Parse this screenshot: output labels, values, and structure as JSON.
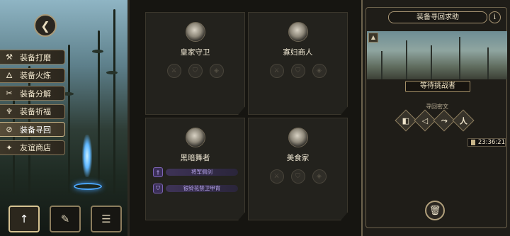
{
  "left_menu": {
    "items": [
      {
        "label": "装备打磨",
        "icon": "hammer-icon",
        "glyph": "⚒",
        "active": false
      },
      {
        "label": "装备火炼",
        "icon": "flame-icon",
        "glyph": "🜂",
        "active": false
      },
      {
        "label": "装备分解",
        "icon": "split-icon",
        "glyph": "✂",
        "active": false
      },
      {
        "label": "装备祈福",
        "icon": "prayer-icon",
        "glyph": "♆",
        "active": false
      },
      {
        "label": "装备寻回",
        "icon": "compass-icon",
        "glyph": "⊘",
        "active": true
      },
      {
        "label": "友谊商店",
        "icon": "shop-icon",
        "glyph": "✦",
        "active": false
      }
    ]
  },
  "bottom_bar": [
    {
      "icon": "equipment-icon",
      "glyph": "↑",
      "active": true
    },
    {
      "icon": "feather-icon",
      "glyph": "✎",
      "active": false
    },
    {
      "icon": "list-icon",
      "glyph": "☰",
      "active": false
    }
  ],
  "cards": [
    {
      "name": "皇家守卫",
      "portrait": "knight-portrait-icon",
      "rewards": []
    },
    {
      "name": "寡妇商人",
      "portrait": "merchant-portrait-icon",
      "rewards": []
    },
    {
      "name": "黑暗舞者",
      "portrait": "dancer-portrait-icon",
      "rewards": [
        "将军佩剑",
        "银铃花禁卫甲胄"
      ]
    },
    {
      "name": "美食家",
      "portrait": "gourmet-portrait-icon",
      "rewards": []
    }
  ],
  "right_panel": {
    "title": "装备寻回求助",
    "info_glyph": "i",
    "status": "等待挑战者",
    "cipher_label": "寻回密文",
    "ciphers": [
      "◧",
      "◁",
      "⤳",
      "人"
    ],
    "timer": "23:36:21",
    "trash_glyph": "🗑"
  },
  "colors": {
    "accent_gold": "#c9b68a",
    "rare_purple": "#7d64b6",
    "glow_blue": "#4ba6ff"
  }
}
